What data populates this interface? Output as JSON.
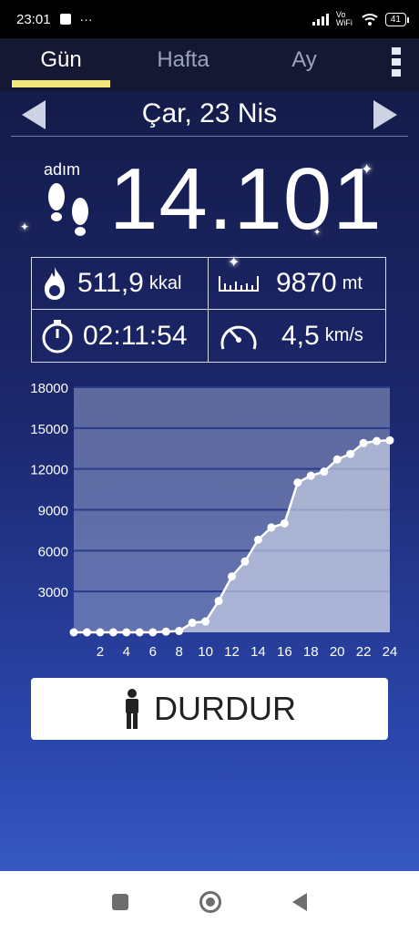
{
  "status_bar": {
    "time": "23:01",
    "dots": "···",
    "network": "Vo WiFi",
    "battery": "41"
  },
  "tabs": [
    {
      "label": "Gün",
      "active": true
    },
    {
      "label": "Hafta",
      "active": false
    },
    {
      "label": "Ay",
      "active": false
    }
  ],
  "date": "Çar, 23 Nis",
  "steps": {
    "label": "adım",
    "value": "14.101"
  },
  "stats": {
    "calories": {
      "value": "511,9",
      "unit": "kkal",
      "icon": "flame-icon"
    },
    "distance": {
      "value": "9870",
      "unit": "mt",
      "icon": "ruler-icon"
    },
    "duration": {
      "value": "02:11:54",
      "icon": "stopwatch-icon"
    },
    "speed": {
      "value": "4,5",
      "unit": "km/s",
      "icon": "speedometer-icon"
    }
  },
  "chart_data": {
    "type": "area",
    "x": [
      0,
      1,
      2,
      3,
      4,
      5,
      6,
      7,
      8,
      9,
      10,
      11,
      12,
      13,
      14,
      15,
      16,
      17,
      18,
      19,
      20,
      21,
      22,
      23,
      24
    ],
    "values": [
      0,
      0,
      0,
      0,
      0,
      0,
      0,
      50,
      100,
      700,
      800,
      2300,
      4100,
      5200,
      6800,
      7700,
      8000,
      11000,
      11500,
      11800,
      12700,
      13100,
      13900,
      14050,
      14101
    ],
    "x_ticks": [
      "2",
      "4",
      "6",
      "8",
      "10",
      "12",
      "14",
      "16",
      "18",
      "20",
      "22",
      "24"
    ],
    "y_ticks": [
      "18000",
      "15000",
      "12000",
      "9000",
      "6000",
      "3000"
    ],
    "xlim": [
      0,
      24
    ],
    "ylim": [
      0,
      18000
    ],
    "grid": true
  },
  "stop_button": {
    "label": "DURDUR"
  },
  "colors": {
    "accent": "#f1e77a",
    "background_top": "#131a44",
    "background_bottom": "#3658c0"
  }
}
